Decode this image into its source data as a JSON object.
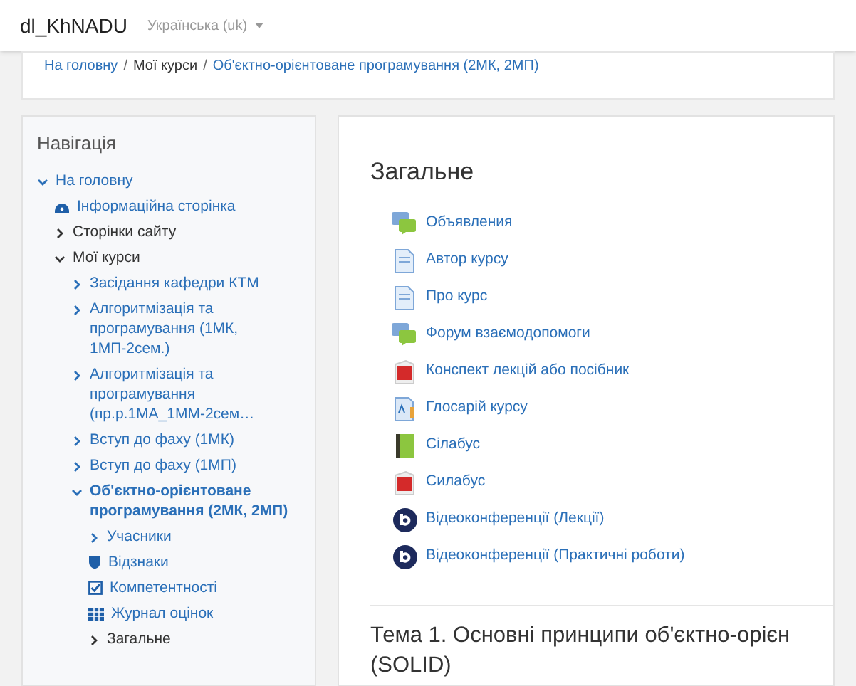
{
  "navbar": {
    "site_name": "dl_KhNADU",
    "language": "Українська (uk)"
  },
  "breadcrumb_separator": "/",
  "breadcrumb": [
    {
      "label": "На головну",
      "link": true
    },
    {
      "label": "Мої курси",
      "link": false
    },
    {
      "label": "Об'єктно-орієнтоване програмування (2МК, 2МП)",
      "link": true
    }
  ],
  "navigation": {
    "title": "Навігація",
    "items": [
      {
        "label": "На головну",
        "kind": "branch",
        "expanded": true,
        "link": true,
        "bold": false,
        "children": [
          {
            "label": "Інформаційна сторінка",
            "kind": "dashboard",
            "link": true,
            "bold": false
          },
          {
            "label": "Сторінки сайту",
            "kind": "branch",
            "expanded": false,
            "link": false,
            "bold": false
          },
          {
            "label": "Мої курси",
            "kind": "branch",
            "expanded": true,
            "link": false,
            "bold": false,
            "children": [
              {
                "label": "Засідання кафедри КТМ",
                "kind": "branch",
                "expanded": false,
                "link": true,
                "bold": false
              },
              {
                "label": "Алгоритмізація та програмування (1МК, 1МП-2сем.)",
                "kind": "branch",
                "expanded": false,
                "link": true,
                "bold": false
              },
              {
                "label": "Алгоритмізація та програмування (пр.р.1МА_1ММ-2сем…",
                "kind": "branch",
                "expanded": false,
                "link": true,
                "bold": false
              },
              {
                "label": "Вступ до фаху (1МК)",
                "kind": "branch",
                "expanded": false,
                "link": true,
                "bold": false
              },
              {
                "label": "Вступ до фаху (1МП)",
                "kind": "branch",
                "expanded": false,
                "link": true,
                "bold": false
              },
              {
                "label": "Об'єктно-орієнтоване програмування (2МК, 2МП)",
                "kind": "branch",
                "expanded": true,
                "link": true,
                "bold": true,
                "children": [
                  {
                    "label": "Учасники",
                    "kind": "branch",
                    "expanded": false,
                    "link": true,
                    "bold": false
                  },
                  {
                    "label": "Відзнаки",
                    "kind": "shield",
                    "link": true,
                    "bold": false
                  },
                  {
                    "label": "Компетентності",
                    "kind": "checkbox",
                    "link": true,
                    "bold": false
                  },
                  {
                    "label": "Журнал оцінок",
                    "kind": "grid",
                    "link": true,
                    "bold": false
                  },
                  {
                    "label": "Загальне",
                    "kind": "branch",
                    "expanded": false,
                    "link": false,
                    "bold": false
                  }
                ]
              }
            ]
          }
        ]
      }
    ]
  },
  "section": {
    "title": "Загальне",
    "activities": [
      {
        "label": "Объявления",
        "kind": "forum"
      },
      {
        "label": "Автор курсу",
        "kind": "page"
      },
      {
        "label": "Про курс",
        "kind": "page"
      },
      {
        "label": "Форум взаємодопомоги",
        "kind": "forum"
      },
      {
        "label": "Конспект лекцій або посібник",
        "kind": "pdf"
      },
      {
        "label": "Глосарій курсу",
        "kind": "glossary"
      },
      {
        "label": "Сілабус",
        "kind": "book"
      },
      {
        "label": "Силабус",
        "kind": "pdf"
      },
      {
        "label": "Відеоконференції (Лекції)",
        "kind": "bbb"
      },
      {
        "label": "Відеоконференції (Практичні роботи)",
        "kind": "bbb"
      }
    ]
  },
  "next_section": {
    "title_lines": [
      "Тема 1. Основні принципи об'єктно-орієн",
      "(SOLID)"
    ]
  }
}
